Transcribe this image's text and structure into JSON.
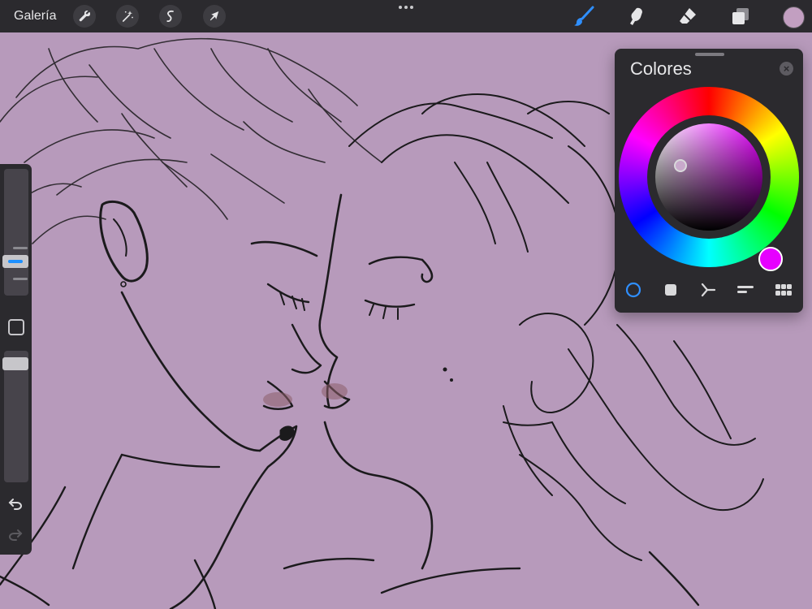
{
  "topbar": {
    "gallery_label": "Galería",
    "tools_left": [
      "wrench-icon",
      "magic-wand-icon",
      "selection-icon",
      "transform-arrow-icon"
    ],
    "tools_right": [
      "brush-icon",
      "smudge-icon",
      "eraser-icon",
      "layers-icon"
    ],
    "active_tool": "brush-icon",
    "current_color": "#c29fc1",
    "accent": "#1e90ff"
  },
  "colors_panel": {
    "title": "Colores",
    "close_symbol": "×",
    "hue": "#e600ff",
    "modes": [
      "disc",
      "classic",
      "harmony",
      "value",
      "palettes"
    ],
    "active_mode": "disc"
  },
  "canvas": {
    "background": "#b79abb"
  }
}
